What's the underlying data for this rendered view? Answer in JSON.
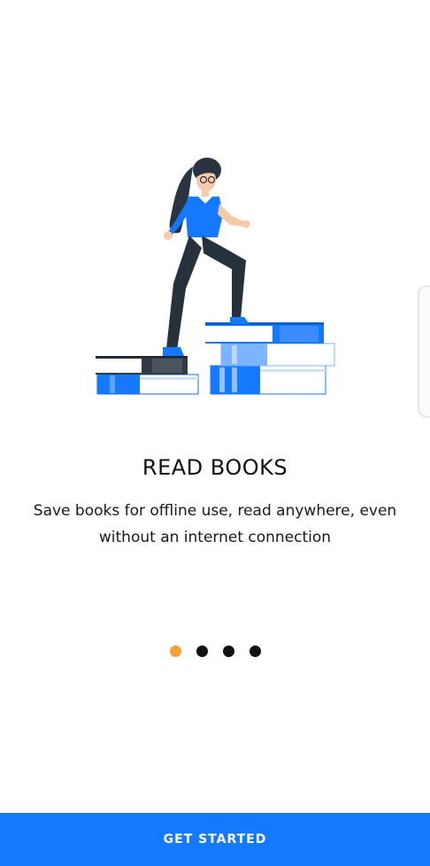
{
  "onboarding": {
    "title": "READ BOOKS",
    "description": "Save books for offline use, read anywhere, even without an internet connection",
    "illustration_icon": "woman-climbing-books-illustration",
    "page_indicator": {
      "total": 4,
      "active_index": 0
    }
  },
  "cta": {
    "label": "GET STARTED"
  },
  "colors": {
    "accent": "#1479ff",
    "active_dot": "#f5a233",
    "inactive_dot": "#111111"
  }
}
